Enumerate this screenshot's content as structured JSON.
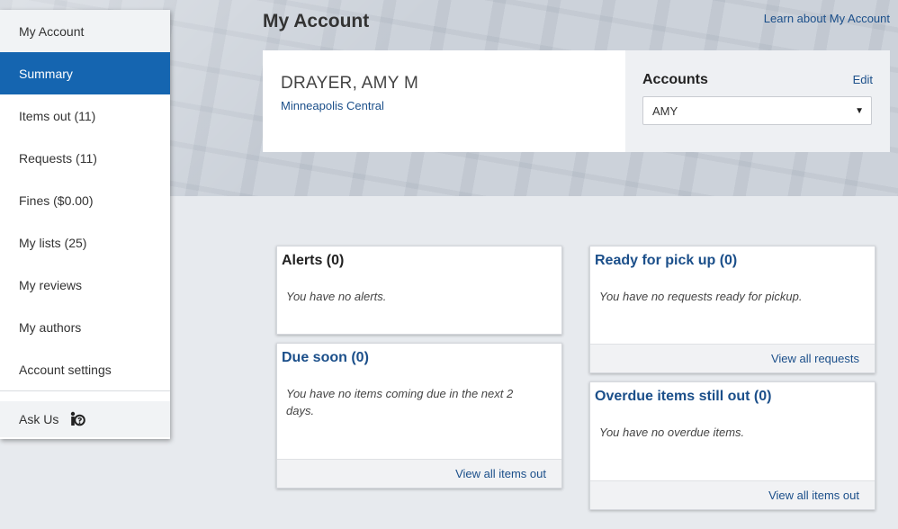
{
  "header": {
    "title": "My Account",
    "learn_link": "Learn about My Account"
  },
  "profile": {
    "name": "DRAYER, AMY M",
    "branch": "Minneapolis Central"
  },
  "accounts": {
    "title": "Accounts",
    "edit_label": "Edit",
    "selected": "AMY"
  },
  "sidebar": {
    "header": "My Account",
    "items": [
      {
        "label": "Summary",
        "active": true
      },
      {
        "label": "Items out (11)"
      },
      {
        "label": "Requests (11)"
      },
      {
        "label": "Fines ($0.00)"
      },
      {
        "label": "My lists (25)"
      },
      {
        "label": "My reviews"
      },
      {
        "label": "My authors"
      },
      {
        "label": "Account settings"
      }
    ],
    "ask_us": "Ask Us",
    "ask_icon": "info-person-icon"
  },
  "panels": {
    "alerts": {
      "title": "Alerts (0)",
      "body": "You have no alerts."
    },
    "due_soon": {
      "title": "Due soon (0)",
      "body": "You have no items coming due in the next 2 days.",
      "footer": "View all items out"
    },
    "ready": {
      "title": "Ready for pick up (0)",
      "body": "You have no requests ready for pickup.",
      "footer": "View all requests"
    },
    "overdue": {
      "title": "Overdue items still out (0)",
      "body": "You have no overdue items.",
      "footer": "View all items out"
    }
  },
  "colors": {
    "accent": "#1565b0",
    "link": "#1b4f8a",
    "background": "#e7eaee"
  }
}
